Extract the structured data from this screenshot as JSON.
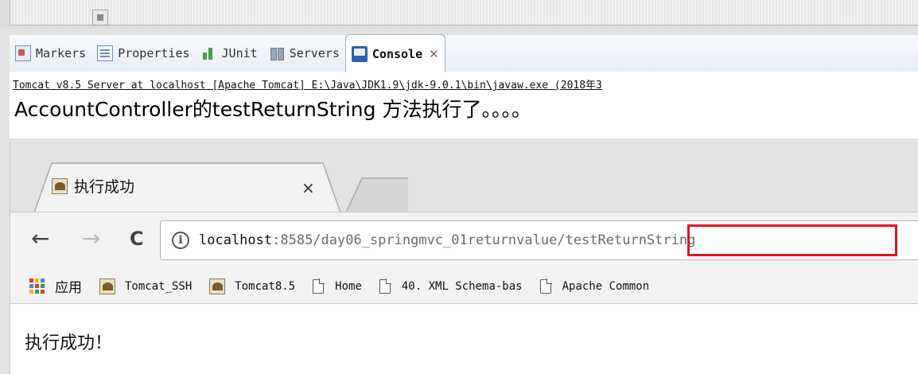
{
  "eclipse": {
    "views": [
      {
        "label": "Markers",
        "icon": "markers-icon"
      },
      {
        "label": "Properties",
        "icon": "properties-icon"
      },
      {
        "label": "JUnit",
        "icon": "junit-icon"
      },
      {
        "label": "Servers",
        "icon": "servers-icon"
      },
      {
        "label": "Console",
        "icon": "console-icon",
        "active": true
      }
    ],
    "console_close": "✕",
    "console_header": "Tomcat v8.5 Server at localhost [Apache Tomcat] E:\\Java\\JDK1.9\\jdk-9.0.1\\bin\\javaw.exe (2018年3",
    "console_output": "AccountController的testReturnString 方法执行了。。。。"
  },
  "browser": {
    "tab_title": "执行成功",
    "tab_close": "×",
    "nav": {
      "back": "←",
      "forward": "→",
      "reload": "C"
    },
    "info_icon": "i",
    "url_host": "localhost",
    "url_rest": ":8585/day06_springmvc_01returnvalue/testReturnString",
    "bookmarks": [
      {
        "label": "应用",
        "type": "apps"
      },
      {
        "label": "Tomcat_SSH",
        "type": "favicon"
      },
      {
        "label": "Tomcat8.5",
        "type": "favicon"
      },
      {
        "label": "Home",
        "type": "doc"
      },
      {
        "label": "40.  XML Schema-bas",
        "type": "doc"
      },
      {
        "label": "Apache Common",
        "type": "doc"
      }
    ],
    "page_text": "执行成功！",
    "highlight_color": "#e0141e"
  }
}
